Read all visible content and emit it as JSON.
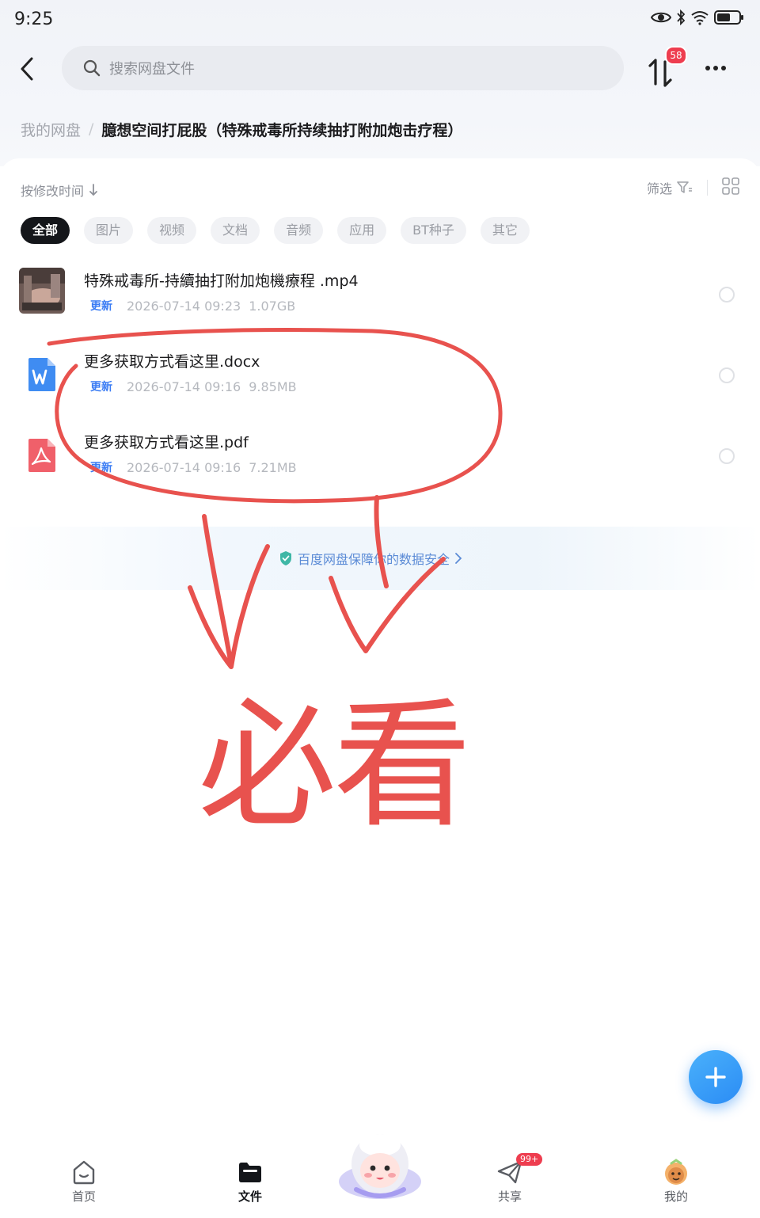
{
  "status_bar": {
    "time": "9:25"
  },
  "nav": {
    "search_placeholder": "搜索网盘文件",
    "transfer_badge": "58"
  },
  "breadcrumb": {
    "root": "我的网盘",
    "separator": "/",
    "current": "臆想空间打屁股（特殊戒毒所持续抽打附加炮击疗程）"
  },
  "toolbar": {
    "sort_label": "按修改时间",
    "filter_label": "筛选"
  },
  "chips": [
    {
      "label": "全部",
      "active": true
    },
    {
      "label": "图片"
    },
    {
      "label": "视频"
    },
    {
      "label": "文档"
    },
    {
      "label": "音频"
    },
    {
      "label": "应用"
    },
    {
      "label": "BT种子"
    },
    {
      "label": "其它"
    }
  ],
  "files": [
    {
      "name": "特殊戒毒所-持續抽打附加炮機療程 .mp4",
      "tag": "更新",
      "date": "2026-07-14  09:23",
      "size": "1.07GB",
      "icon": "video-thumbnail"
    },
    {
      "name": "更多获取方式看这里.docx",
      "tag": "更新",
      "date": "2026-07-14  09:16",
      "size": "9.85MB",
      "icon": "word-doc-icon"
    },
    {
      "name": "更多获取方式看这里.pdf",
      "tag": "更新",
      "date": "2026-07-14  09:16",
      "size": "7.21MB",
      "icon": "pdf-icon"
    }
  ],
  "security_banner": {
    "text": "百度网盘保障你的数据安全"
  },
  "annotation": {
    "text": "必看",
    "color": "#e8524e"
  },
  "tabbar": {
    "tabs": [
      {
        "label": "首页",
        "icon": "home-icon"
      },
      {
        "label": "文件",
        "icon": "folder-icon",
        "active": true
      },
      {
        "label": "共享",
        "icon": "share-icon",
        "badge": "99+"
      },
      {
        "label": "我的",
        "icon": "profile-avatar-icon"
      }
    ]
  },
  "colors": {
    "accent": "#2b8cf5",
    "badge": "#ee3d4f",
    "annotation": "#e8524e"
  }
}
